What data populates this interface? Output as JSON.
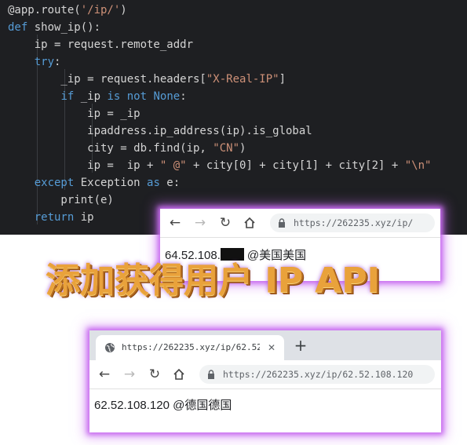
{
  "editor": {
    "lines": [
      "@app.route('/ip/')",
      "def show_ip():",
      "    ip = request.remote_addr",
      "    try:",
      "        _ip = request.headers[\"X-Real-IP\"]",
      "        if _ip is not None:",
      "            ip = _ip",
      "            ipaddress.ip_address(ip).is_global",
      "            city = db.find(ip, \"CN\")",
      "            ip =  ip + \" @\" + city[0] + city[1] + city[2] + \"\\n\"",
      "    except Exception as e:",
      "        print(e)",
      "    return ip"
    ]
  },
  "browser1": {
    "url": "https://262235.xyz/ip/",
    "result_prefix": "64.52.108.",
    "result_suffix": "@美国美国"
  },
  "headline": "添加获得用户 IP API",
  "browser2": {
    "tab_title": "https://262235.xyz/ip/62.52.1",
    "url": "https://262235.xyz/ip/62.52.108.120",
    "result": "62.52.108.120 @德国德国"
  },
  "colors": {
    "editor_bg": "#1e1f22",
    "keyword": "#569cd6",
    "string": "#ce9178",
    "glow": "#c86cf0",
    "headline": "#e9a23b"
  },
  "icons": [
    "back-arrow-icon",
    "forward-arrow-icon",
    "reload-icon",
    "home-icon",
    "lock-icon",
    "globe-icon",
    "close-icon",
    "plus-icon"
  ]
}
